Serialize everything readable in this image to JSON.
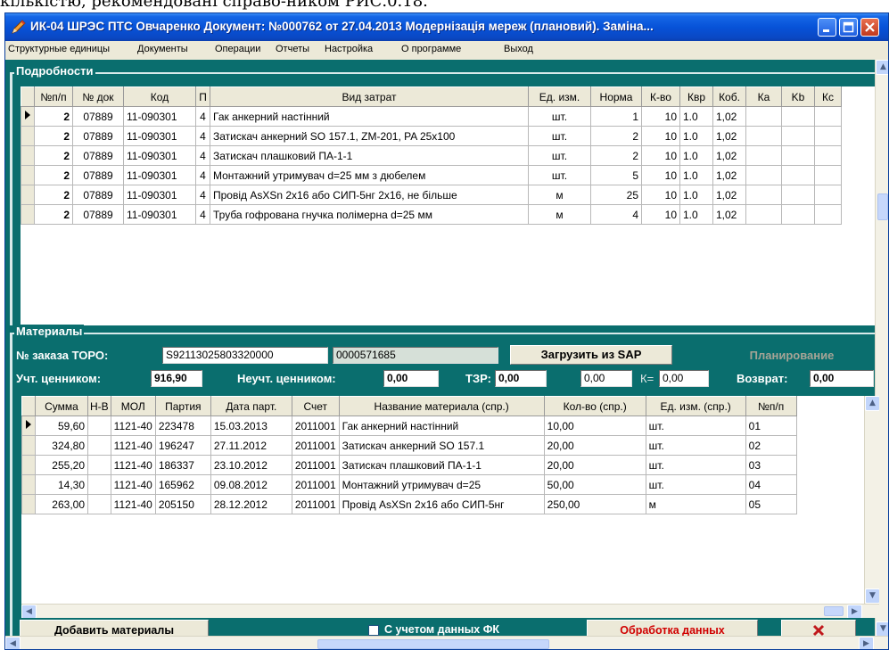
{
  "top_text": "кількістю, рекомендовані справо-ником РИС.0.18.",
  "window": {
    "title": "ИК-04 ШРЭС ПТС Овчаренко Документ: №000762 от 27.04.2013   Модернізація мереж (плановий). Заміна..."
  },
  "menu": [
    "Структурные единицы",
    "Документы",
    "Операции",
    "Отчеты",
    "Настройка",
    "О программе",
    "Выход"
  ],
  "details": {
    "label": "Подробности",
    "columns": [
      "№п/п",
      "№ док",
      "Код",
      "П",
      "Вид затрат",
      "Ед. изм.",
      "Норма",
      "К-во",
      "Квр",
      "Коб.",
      "Ка",
      "Kb",
      "Кс"
    ],
    "rows": [
      [
        "2",
        "07889",
        "11-090301",
        "4",
        "Гак анкерний настінний",
        "шт.",
        "1",
        "10",
        "1.0",
        "1,02",
        "",
        "",
        ""
      ],
      [
        "2",
        "07889",
        "11-090301",
        "4",
        "Затискач анкерний SO 157.1, ZM-201, PA 25x100",
        "шт.",
        "2",
        "10",
        "1.0",
        "1,02",
        "",
        "",
        ""
      ],
      [
        "2",
        "07889",
        "11-090301",
        "4",
        "Затискач плашковий ПА-1-1",
        "шт.",
        "2",
        "10",
        "1.0",
        "1,02",
        "",
        "",
        ""
      ],
      [
        "2",
        "07889",
        "11-090301",
        "4",
        "Монтажний утримувач d=25 мм з дюбелем",
        "шт.",
        "5",
        "10",
        "1.0",
        "1,02",
        "",
        "",
        ""
      ],
      [
        "2",
        "07889",
        "11-090301",
        "4",
        "Провід AsXSn 2x16 або СИП-5нг 2x16, не більше",
        "м",
        "25",
        "10",
        "1.0",
        "1,02",
        "",
        "",
        ""
      ],
      [
        "2",
        "07889",
        "11-090301",
        "4",
        "Труба гофрована гнучка полімерна d=25 мм",
        "м",
        "4",
        "10",
        "1.0",
        "1,02",
        "",
        "",
        ""
      ]
    ]
  },
  "materials": {
    "label": "Материалы",
    "order_label": "№ заказа ТОРО:",
    "order_value": "S92113025803320000",
    "order_value2": "0000571685",
    "load_button": "Загрузить из SAP",
    "plan_button": "Планирование",
    "accounted_label": "Учт. ценником:",
    "accounted_value": "916,90",
    "unaccounted_label": "Неучт. ценником:",
    "unaccounted_value": "0,00",
    "tzr_label": "ТЗР:",
    "tzr_value": "0,00",
    "tzr_value2": "0,00",
    "k_label": "К=",
    "k_value": "0,00",
    "return_label": "Возврат:",
    "return_value": "0,00",
    "columns": [
      "Сумма",
      "Н-В",
      "МОЛ",
      "Партия",
      "Дата парт.",
      "Счет",
      "Название материала (спр.)",
      "Кол-во (спр.)",
      "Ед. изм. (спр.)",
      "№п/п"
    ],
    "rows": [
      [
        "59,60",
        "",
        "1121-40",
        "223478",
        "15.03.2013",
        "2011001",
        "Гак анкерний настінний",
        "10,00",
        "шт.",
        "01"
      ],
      [
        "324,80",
        "",
        "1121-40",
        "196247",
        "27.11.2012",
        "2011001",
        "Затискач анкерний SO 157.1",
        "20,00",
        "шт.",
        "02"
      ],
      [
        "255,20",
        "",
        "1121-40",
        "186337",
        "23.10.2012",
        "2011001",
        "Затискач плашковий ПА-1-1",
        "20,00",
        "шт.",
        "03"
      ],
      [
        "14,30",
        "",
        "1121-40",
        "165962",
        "09.08.2012",
        "2011001",
        "Монтажний утримувач d=25",
        "50,00",
        "шт.",
        "04"
      ],
      [
        "263,00",
        "",
        "1121-40",
        "205150",
        "28.12.2012",
        "2011001",
        "Провід AsXSn 2x16 або СИП-5нг",
        "250,00",
        "м",
        "05"
      ]
    ]
  },
  "bottom": {
    "add_button": "Добавить материалы",
    "fk_checkbox": "С учетом данных ФК",
    "process_button": "Обработка данных",
    "cancel_icon": "red-x-icon"
  },
  "colors": {
    "window_bg": "#0a6e6e",
    "titlebar": "#0752d8",
    "menubar": "#ece9d8",
    "process_text": "#d00000"
  }
}
